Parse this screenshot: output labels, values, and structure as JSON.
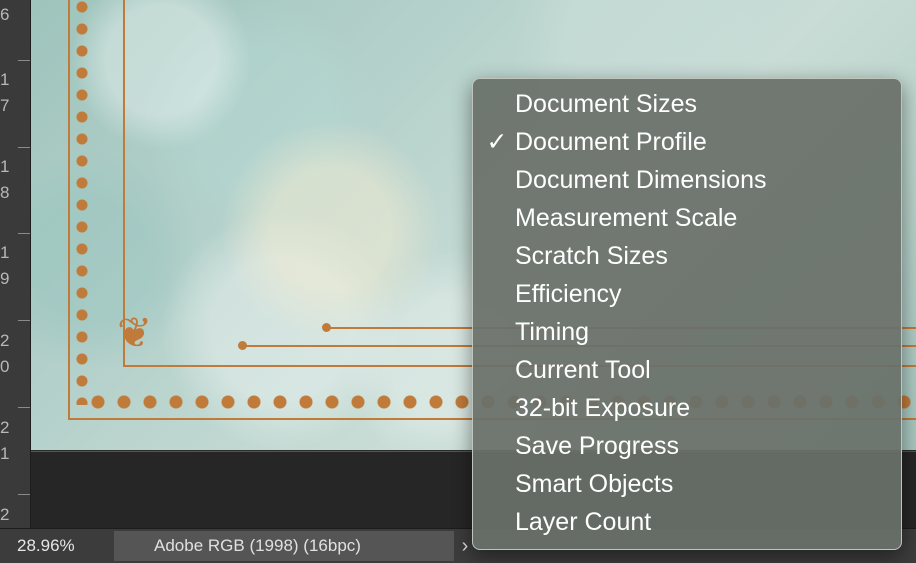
{
  "ruler": {
    "labels": [
      "6",
      "1",
      "7",
      "1",
      "8",
      "1",
      "9",
      "2",
      "0",
      "2",
      "1",
      "2"
    ]
  },
  "status": {
    "zoom": "28.96%",
    "profile": "Adobe RGB (1998) (16bpc)",
    "menu_arrow_icon": "chevron-right-icon"
  },
  "menu": {
    "checked_icon": "checkmark-icon",
    "check_glyph": "✓",
    "items": [
      {
        "label": "Document Sizes",
        "checked": false
      },
      {
        "label": "Document Profile",
        "checked": true
      },
      {
        "label": "Document Dimensions",
        "checked": false
      },
      {
        "label": "Measurement Scale",
        "checked": false
      },
      {
        "label": "Scratch Sizes",
        "checked": false
      },
      {
        "label": "Efficiency",
        "checked": false
      },
      {
        "label": "Timing",
        "checked": false
      },
      {
        "label": "Current Tool",
        "checked": false
      },
      {
        "label": "32-bit Exposure",
        "checked": false
      },
      {
        "label": "Save Progress",
        "checked": false
      },
      {
        "label": "Smart Objects",
        "checked": false
      },
      {
        "label": "Layer Count",
        "checked": false
      }
    ]
  },
  "colors": {
    "ornament": "#c07a3a",
    "menu_bg": "#697069",
    "statusbar_bg": "#3c3c3c"
  }
}
